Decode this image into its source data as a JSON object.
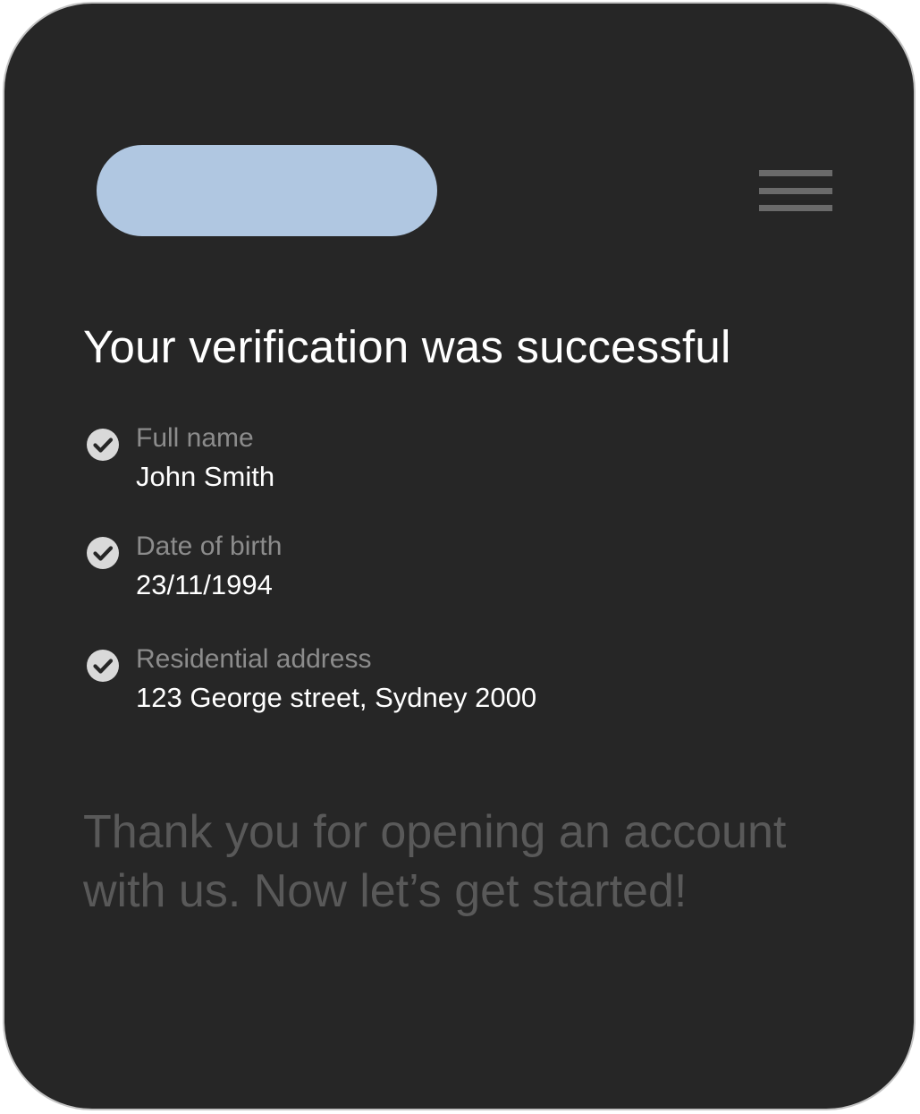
{
  "header": {
    "logo_color": "#b0c7e1",
    "menu_icon": "hamburger-menu-icon"
  },
  "title": "Your verification was successful",
  "fields": [
    {
      "icon": "check-circle-icon",
      "label": "Full name",
      "value": "John Smith"
    },
    {
      "icon": "check-circle-icon",
      "label": "Date of birth",
      "value": "23/11/1994"
    },
    {
      "icon": "check-circle-icon",
      "label": "Residential address",
      "value": "123 George street, Sydney 2000"
    }
  ],
  "message": "Thank you for opening an account with us. Now let’s get started!",
  "colors": {
    "background": "#262626",
    "title": "#ffffff",
    "label": "#8c8c8c",
    "message": "#595959",
    "check": "#d9d9d9"
  }
}
